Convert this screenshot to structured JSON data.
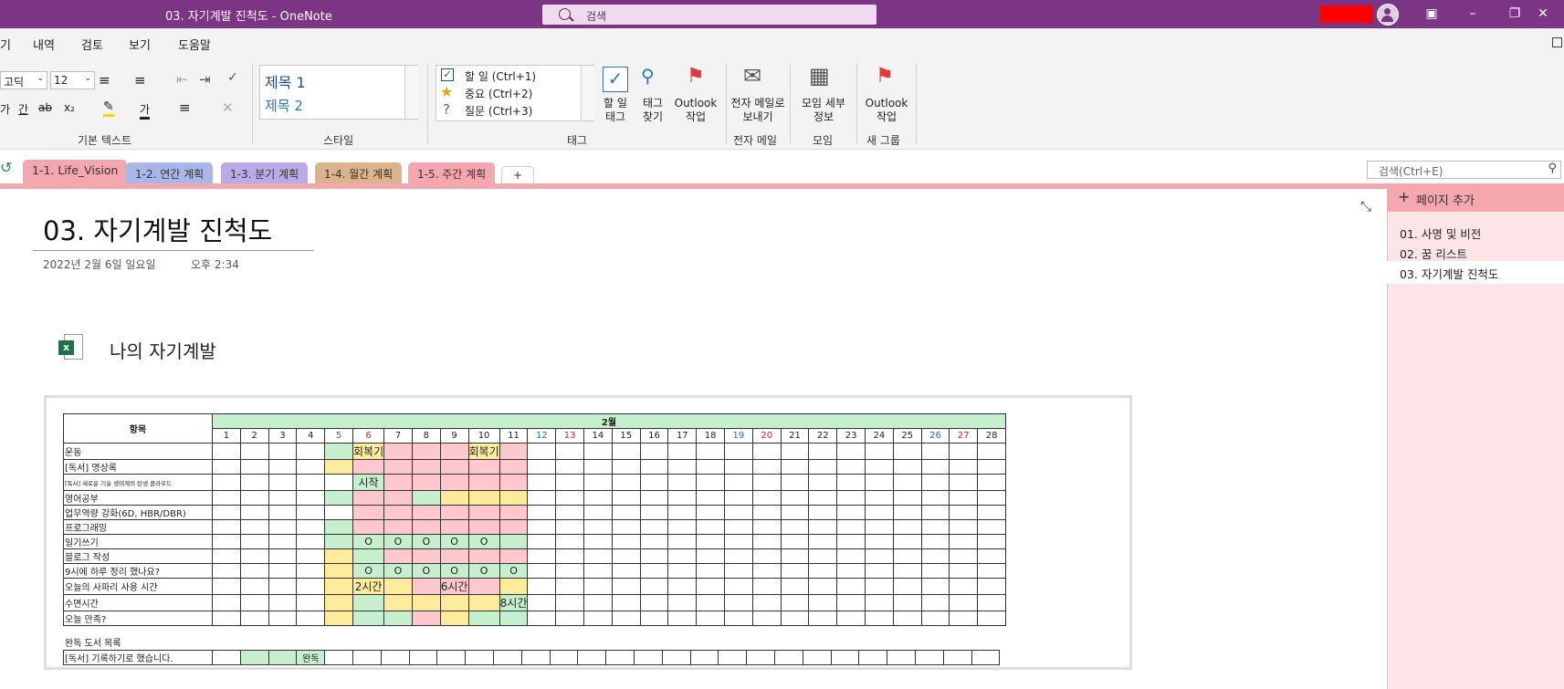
{
  "window": {
    "title": "03. 자기계발 진척도  -  OneNote",
    "search_placeholder": "검색"
  },
  "menu": {
    "items": [
      "기",
      "내역",
      "검토",
      "보기",
      "도움말"
    ]
  },
  "ribbon": {
    "font_name": "고딕",
    "font_size": "12",
    "basic_text_label": "기본 텍스트",
    "styles": {
      "h1": "제목 1",
      "h2": "제목 2",
      "label": "스타일"
    },
    "tags": {
      "todo": "할 일 (Ctrl+1)",
      "important": "중요 (Ctrl+2)",
      "question": "질문 (Ctrl+3)",
      "label": "태그"
    },
    "todo_tag_btn": "할 일 태그",
    "find_tags_btn": "태그 찾기",
    "outlook_task_btn": "Outlook 작업",
    "email_btn": "전자 메일로 보내기",
    "email_label": "전자 메일",
    "meeting_btn": "모임 세부 정보",
    "meeting_label": "모임",
    "new_outlook_btn": "Outlook 작업",
    "new_group_label": "새 그룹"
  },
  "tabs": [
    {
      "label": "1-1. Life_Vision",
      "color": "#f4a7ae"
    },
    {
      "label": "1-2. 연간 계획",
      "color": "#a9b6e8"
    },
    {
      "label": "1-3. 분기 계획",
      "color": "#b9abe6"
    },
    {
      "label": "1-4. 월간 계획",
      "color": "#dcb48c"
    },
    {
      "label": "1-5. 주간 계획",
      "color": "#f4a7ae"
    }
  ],
  "add_tab": "+",
  "page_search_placeholder": "검색(Ctrl+E)",
  "pages_panel": {
    "add_page": "페이지 추가",
    "pages": [
      "01. 사명 및 비전",
      "02. 꿈 리스트",
      "03. 자기계발 진척도"
    ]
  },
  "page": {
    "title": "03. 자기계발 진척도",
    "date": "2022년 2월 6일 일요일",
    "time": "오후 2:34",
    "embed_heading": "나의 자기계발"
  },
  "sheet": {
    "header_item": "항목",
    "month": "2월",
    "days": [
      "1",
      "2",
      "3",
      "4",
      "5",
      "6",
      "7",
      "8",
      "9",
      "10",
      "11",
      "12",
      "13",
      "14",
      "15",
      "16",
      "17",
      "18",
      "19",
      "20",
      "21",
      "22",
      "23",
      "24",
      "25",
      "26",
      "27",
      "28"
    ],
    "rows": [
      "운동",
      "[독서] 명상록",
      "[독서] 새로운 기술 생태계의 탄생 클라우드",
      "영어공부",
      "업무역량 강화(6D, HBR/DBR)",
      "프로그래밍",
      "일기쓰기",
      "블로그 작성",
      "9시에 하루 정리 했나요?",
      "오늘의 사파리 사용 시간",
      "수면시간",
      "오늘 만족?"
    ],
    "marks": {
      "restart": "회복기",
      "start": "시작",
      "circle": "O",
      "hours2": "2시간",
      "hours6": "6시간",
      "hours8": "8시간"
    },
    "books_heading": "완독 도서 목록",
    "book_row": "[독서] 기록하기로 했습니다.",
    "book_done": "완독"
  }
}
